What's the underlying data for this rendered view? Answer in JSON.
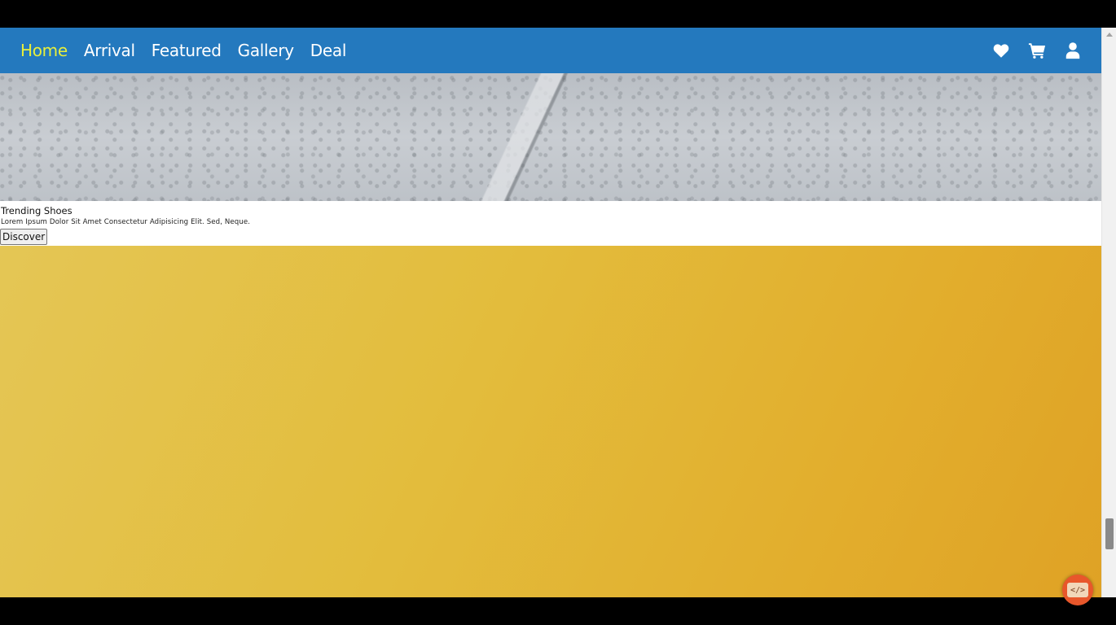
{
  "nav": {
    "links": [
      {
        "label": "Home",
        "active": true
      },
      {
        "label": "Arrival",
        "active": false
      },
      {
        "label": "Featured",
        "active": false
      },
      {
        "label": "Gallery",
        "active": false
      },
      {
        "label": "Deal",
        "active": false
      }
    ],
    "icons": [
      "heart-icon",
      "cart-icon",
      "user-icon"
    ],
    "background_color": "#2479be",
    "active_color": "#e8ef3b"
  },
  "promo": {
    "title": "Trending Shoes",
    "description": "Lorem Ipsum Dolor Sit Amet Consectetur Adipisicing Elit. Sed, Neque.",
    "button_label": "Discover"
  },
  "badge": {
    "label": "</>",
    "color": "#e8572b"
  },
  "colors": {
    "banner_yellow": "#e3bd3d",
    "concrete_gray": "#c4c8cd"
  }
}
